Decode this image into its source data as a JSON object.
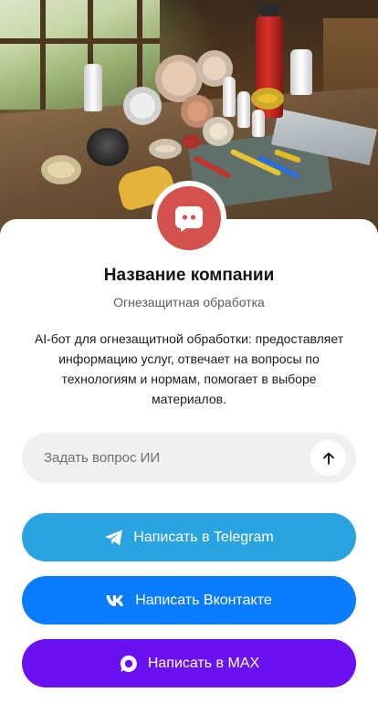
{
  "hero": {
    "image_icon": "fireproofing-materials-photo"
  },
  "company": {
    "avatar_icon": "chat-bubble-icon",
    "name": "Название компании",
    "category": "Огнезащитная обработка",
    "description": "AI-бот для огнезащитной обработки: предоставляет информацию услуг, отвечает на вопросы по технологиям и нормам, помогает в выборе материалов."
  },
  "ask": {
    "placeholder": "Задать вопрос ИИ",
    "value": "",
    "send_icon": "arrow-up-icon"
  },
  "buttons": [
    {
      "label": "Написать в Telegram",
      "icon": "telegram-icon",
      "color": "#2aa4e0"
    },
    {
      "label": "Написать Вконтакте",
      "icon": "vk-icon",
      "color": "#0a7cff"
    },
    {
      "label": "Написать в MAX",
      "icon": "max-icon",
      "color": "#6b10f2"
    }
  ],
  "colors": {
    "avatar": "#d4524d",
    "input_bg": "#f0f0f0",
    "text": "#141414",
    "muted": "#5c5c5c"
  }
}
